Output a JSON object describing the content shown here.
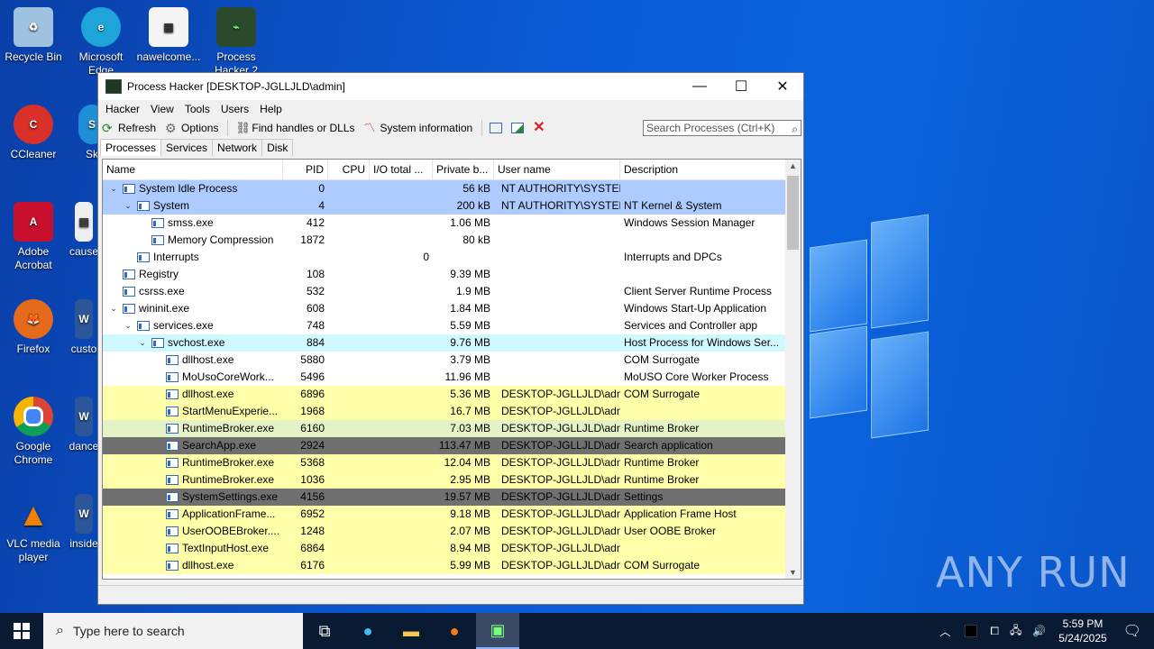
{
  "desktop": {
    "icons": [
      {
        "label": "Recycle Bin",
        "icon": "recycle-bin-icon"
      },
      {
        "label": "Microsoft Edge",
        "icon": "edge-icon"
      },
      {
        "label": "nawelcome...",
        "icon": "image-file-icon"
      },
      {
        "label": "Process Hacker 2",
        "icon": "process-hacker-icon"
      },
      {
        "label": "CCleaner",
        "icon": "ccleaner-icon"
      },
      {
        "label": "Sk",
        "icon": "skype-icon"
      },
      {
        "label": "Adobe Acrobat",
        "icon": "acrobat-icon"
      },
      {
        "label": "cause",
        "icon": "document-icon"
      },
      {
        "label": "Firefox",
        "icon": "firefox-icon"
      },
      {
        "label": "custo",
        "icon": "word-icon"
      },
      {
        "label": "Google Chrome",
        "icon": "chrome-icon"
      },
      {
        "label": "dance",
        "icon": "word-icon"
      },
      {
        "label": "VLC media player",
        "icon": "vlc-icon"
      },
      {
        "label": "inside",
        "icon": "word-icon"
      }
    ],
    "watermark": "ANY RUN"
  },
  "window": {
    "title": "Process Hacker [DESKTOP-JGLLJLD\\admin]",
    "minimize": "—",
    "maximize": "☐",
    "close": "✕",
    "menu": [
      "Hacker",
      "View",
      "Tools",
      "Users",
      "Help"
    ],
    "toolbar": {
      "refresh": "Refresh",
      "options": "Options",
      "find": "Find handles or DLLs",
      "sysinfo": "System information"
    },
    "search_placeholder": "Search Processes (Ctrl+K)",
    "tabs": [
      "Processes",
      "Services",
      "Network",
      "Disk"
    ],
    "columns": [
      "Name",
      "PID",
      "CPU",
      "I/O total ...",
      "Private b...",
      "User name",
      "Description"
    ],
    "rows": [
      {
        "name": "System Idle Process",
        "pid": "0",
        "cpu": "",
        "io": "",
        "priv": "56 kB",
        "user": "NT AUTHORITY\\SYSTEM",
        "desc": "",
        "bg": "blue",
        "tog": "v"
      },
      {
        "name": "System",
        "pid": "4",
        "cpu": "",
        "io": "",
        "priv": "200 kB",
        "user": "NT AUTHORITY\\SYSTEM",
        "desc": "NT Kernel & System",
        "bg": "blue",
        "tog": "v"
      },
      {
        "name": "smss.exe",
        "pid": "412",
        "cpu": "",
        "io": "",
        "priv": "1.06 MB",
        "user": "",
        "desc": "Windows Session Manager",
        "bg": "",
        "tog": ""
      },
      {
        "name": "Memory Compression",
        "pid": "1872",
        "cpu": "",
        "io": "",
        "priv": "80 kB",
        "user": "",
        "desc": "",
        "bg": "",
        "tog": ""
      },
      {
        "name": "Interrupts",
        "pid": "",
        "cpu": "",
        "io": "0",
        "priv": "",
        "user": "",
        "desc": "Interrupts and DPCs",
        "bg": "",
        "tog": ""
      },
      {
        "name": "Registry",
        "pid": "108",
        "cpu": "",
        "io": "",
        "priv": "9.39 MB",
        "user": "",
        "desc": "",
        "bg": "",
        "tog": ""
      },
      {
        "name": "csrss.exe",
        "pid": "532",
        "cpu": "",
        "io": "",
        "priv": "1.9 MB",
        "user": "",
        "desc": "Client Server Runtime Process",
        "bg": "",
        "tog": ""
      },
      {
        "name": "wininit.exe",
        "pid": "608",
        "cpu": "",
        "io": "",
        "priv": "1.84 MB",
        "user": "",
        "desc": "Windows Start-Up Application",
        "bg": "",
        "tog": "v"
      },
      {
        "name": "services.exe",
        "pid": "748",
        "cpu": "",
        "io": "",
        "priv": "5.59 MB",
        "user": "",
        "desc": "Services and Controller app",
        "bg": "",
        "tog": "v"
      },
      {
        "name": "svchost.exe",
        "pid": "884",
        "cpu": "",
        "io": "",
        "priv": "9.76 MB",
        "user": "",
        "desc": "Host Process for Windows Ser...",
        "bg": "cyan",
        "tog": "v"
      },
      {
        "name": "dllhost.exe",
        "pid": "5880",
        "cpu": "",
        "io": "",
        "priv": "3.79 MB",
        "user": "",
        "desc": "COM Surrogate",
        "bg": "",
        "tog": ""
      },
      {
        "name": "MoUsoCoreWork...",
        "pid": "5496",
        "cpu": "",
        "io": "",
        "priv": "11.96 MB",
        "user": "",
        "desc": "MoUSO Core Worker Process",
        "bg": "",
        "tog": ""
      },
      {
        "name": "dllhost.exe",
        "pid": "6896",
        "cpu": "",
        "io": "",
        "priv": "5.36 MB",
        "user": "DESKTOP-JGLLJLD\\admi",
        "desc": "COM Surrogate",
        "bg": "yellow",
        "tog": ""
      },
      {
        "name": "StartMenuExperie...",
        "pid": "1968",
        "cpu": "",
        "io": "",
        "priv": "16.7 MB",
        "user": "DESKTOP-JGLLJLD\\admi",
        "desc": "",
        "bg": "yellow",
        "tog": ""
      },
      {
        "name": "RuntimeBroker.exe",
        "pid": "6160",
        "cpu": "",
        "io": "",
        "priv": "7.03 MB",
        "user": "DESKTOP-JGLLJLD\\admi",
        "desc": "Runtime Broker",
        "bg": "green",
        "tog": ""
      },
      {
        "name": "SearchApp.exe",
        "pid": "2924",
        "cpu": "",
        "io": "",
        "priv": "113.47 MB",
        "user": "DESKTOP-JGLLJLD\\admi",
        "desc": "Search application",
        "bg": "gray",
        "tog": ""
      },
      {
        "name": "RuntimeBroker.exe",
        "pid": "5368",
        "cpu": "",
        "io": "",
        "priv": "12.04 MB",
        "user": "DESKTOP-JGLLJLD\\admi",
        "desc": "Runtime Broker",
        "bg": "yellow",
        "tog": ""
      },
      {
        "name": "RuntimeBroker.exe",
        "pid": "1036",
        "cpu": "",
        "io": "",
        "priv": "2.95 MB",
        "user": "DESKTOP-JGLLJLD\\admi",
        "desc": "Runtime Broker",
        "bg": "yellow",
        "tog": ""
      },
      {
        "name": "SystemSettings.exe",
        "pid": "4156",
        "cpu": "",
        "io": "",
        "priv": "19.57 MB",
        "user": "DESKTOP-JGLLJLD\\admi",
        "desc": "Settings",
        "bg": "gray",
        "tog": ""
      },
      {
        "name": "ApplicationFrame...",
        "pid": "6952",
        "cpu": "",
        "io": "",
        "priv": "9.18 MB",
        "user": "DESKTOP-JGLLJLD\\admi",
        "desc": "Application Frame Host",
        "bg": "yellow",
        "tog": ""
      },
      {
        "name": "UserOOBEBroker....",
        "pid": "1248",
        "cpu": "",
        "io": "",
        "priv": "2.07 MB",
        "user": "DESKTOP-JGLLJLD\\admi",
        "desc": "User OOBE Broker",
        "bg": "yellow",
        "tog": ""
      },
      {
        "name": "TextInputHost.exe",
        "pid": "6864",
        "cpu": "",
        "io": "",
        "priv": "8.94 MB",
        "user": "DESKTOP-JGLLJLD\\admi",
        "desc": "",
        "bg": "yellow",
        "tog": ""
      },
      {
        "name": "dllhost.exe",
        "pid": "6176",
        "cpu": "",
        "io": "",
        "priv": "5.99 MB",
        "user": "DESKTOP-JGLLJLD\\admi",
        "desc": "COM Surrogate",
        "bg": "yellow",
        "tog": ""
      }
    ]
  },
  "taskbar": {
    "search_placeholder": "Type here to search",
    "time": "5:59 PM",
    "date": "5/24/2025"
  }
}
